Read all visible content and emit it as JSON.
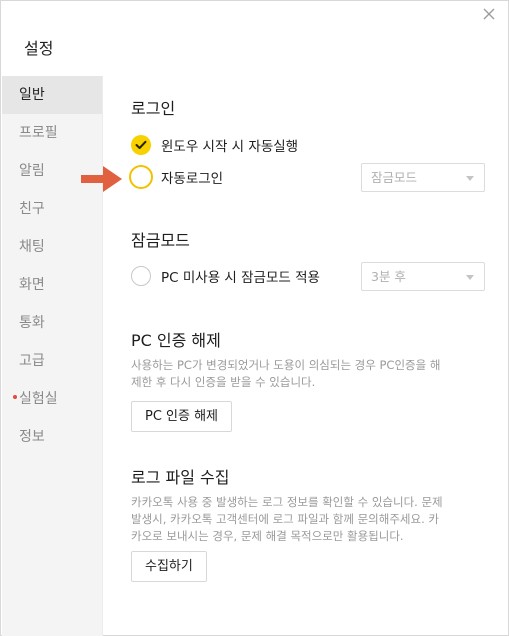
{
  "window": {
    "title": "설정"
  },
  "sidebar": {
    "items": [
      {
        "label": "일반"
      },
      {
        "label": "프로필"
      },
      {
        "label": "알림"
      },
      {
        "label": "친구"
      },
      {
        "label": "채팅"
      },
      {
        "label": "화면"
      },
      {
        "label": "통화"
      },
      {
        "label": "고급"
      },
      {
        "label": "실험실"
      },
      {
        "label": "정보"
      }
    ]
  },
  "login": {
    "title": "로그인",
    "startup_label": "윈도우 시작 시 자동실행",
    "startup_checked": true,
    "autologin_label": "자동로그인",
    "autologin_checked": false,
    "autologin_select": "잠금모드"
  },
  "lock": {
    "title": "잠금모드",
    "idle_label": "PC 미사용 시 잠금모드 적용",
    "idle_checked": false,
    "idle_select": "3분 후"
  },
  "pc_auth": {
    "title": "PC 인증 해제",
    "desc_line1": "사용하는 PC가 변경되었거나 도용이 의심되는 경우 PC인증을 해",
    "desc_line2": "제한 후 다시 인증을 받을 수 있습니다.",
    "button": "PC 인증 해제"
  },
  "log": {
    "title": "로그 파일 수집",
    "desc_line1": "카카오톡 사용 중 발생하는 로그 정보를 확인할 수 있습니다. 문제",
    "desc_line2": "발생시, 카카오톡 고객센터에 로그 파일과 함께 문의해주세요. 카",
    "desc_line3": "카오로 보내시는 경우, 문제 해결 목적으로만 활용됩니다.",
    "button": "수집하기"
  },
  "colors": {
    "accent": "#f7d100",
    "arrow": "#e0603f",
    "lab_dot": "#e8483b"
  },
  "icons": [
    "close-icon",
    "check-icon",
    "arrow-right-icon",
    "chevron-down-icon"
  ]
}
